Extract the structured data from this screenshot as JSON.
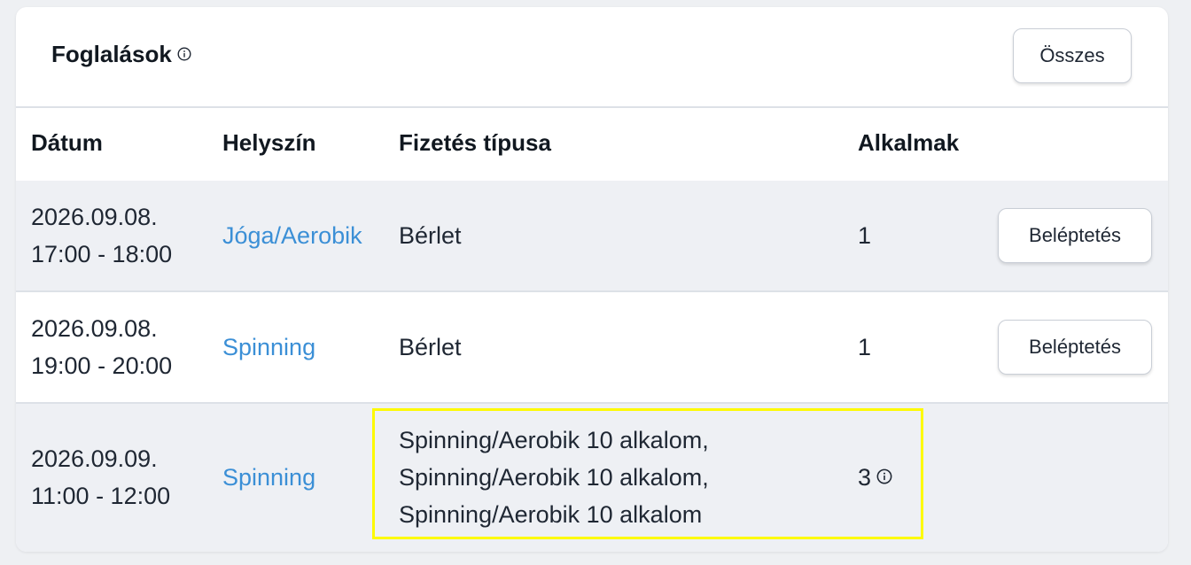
{
  "title": "Foglalások",
  "all_button": "Összes",
  "columns": {
    "date": "Dátum",
    "location": "Helyszín",
    "payment": "Fizetés típusa",
    "count": "Alkalmak"
  },
  "rows": [
    {
      "date": "2026.09.08.",
      "time": "17:00 - 18:00",
      "location": "Jóga/Aerobik",
      "payment": [
        "Bérlet"
      ],
      "count": "1",
      "action": "Beléptetés"
    },
    {
      "date": "2026.09.08.",
      "time": "19:00 - 20:00",
      "location": "Spinning",
      "payment": [
        "Bérlet"
      ],
      "count": "1",
      "action": "Beléptetés"
    },
    {
      "date": "2026.09.09.",
      "time": "11:00 - 12:00",
      "location": "Spinning",
      "payment": [
        "Spinning/Aerobik 10 alkalom,",
        "Spinning/Aerobik 10 alkalom,",
        "Spinning/Aerobik 10 alkalom"
      ],
      "count": "3"
    }
  ],
  "icons": {
    "title_info": "info-icon",
    "count_info": "info-icon"
  },
  "colors": {
    "link": "#3b8fd6",
    "row_alt": "#eef0f4",
    "highlight": "#fdfa02"
  }
}
